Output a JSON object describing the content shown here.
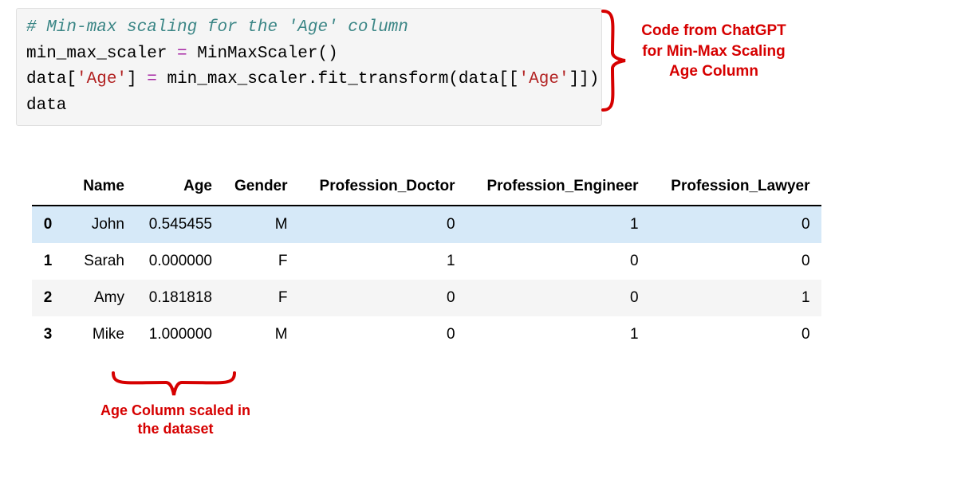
{
  "code": {
    "comment": "# Min-max scaling for the 'Age' column",
    "line1_a": "min_max_scaler ",
    "line1_op": "=",
    "line1_b": " MinMaxScaler()",
    "line2_a": "data[",
    "line2_str1": "'Age'",
    "line2_b": "] ",
    "line2_op": "=",
    "line2_c": " min_max_scaler.fit_transform(data[[",
    "line2_str2": "'Age'",
    "line2_d": "]])",
    "line3": "data"
  },
  "annotations": {
    "right_l1": "Code from ChatGPT",
    "right_l2": "for Min-Max Scaling",
    "right_l3": "Age Column",
    "bottom_l1": "Age Column scaled in",
    "bottom_l2": "the dataset"
  },
  "table": {
    "headers": {
      "name": "Name",
      "age": "Age",
      "gender": "Gender",
      "pd": "Profession_Doctor",
      "pe": "Profession_Engineer",
      "pl": "Profession_Lawyer"
    },
    "rows": [
      {
        "idx": "0",
        "name": "John",
        "age": "0.545455",
        "gender": "M",
        "pd": "0",
        "pe": "1",
        "pl": "0"
      },
      {
        "idx": "1",
        "name": "Sarah",
        "age": "0.000000",
        "gender": "F",
        "pd": "1",
        "pe": "0",
        "pl": "0"
      },
      {
        "idx": "2",
        "name": "Amy",
        "age": "0.181818",
        "gender": "F",
        "pd": "0",
        "pe": "0",
        "pl": "1"
      },
      {
        "idx": "3",
        "name": "Mike",
        "age": "1.000000",
        "gender": "M",
        "pd": "0",
        "pe": "1",
        "pl": "0"
      }
    ]
  },
  "chart_data": {
    "type": "table",
    "columns": [
      "Name",
      "Age",
      "Gender",
      "Profession_Doctor",
      "Profession_Engineer",
      "Profession_Lawyer"
    ],
    "rows": [
      [
        "John",
        0.545455,
        "M",
        0,
        1,
        0
      ],
      [
        "Sarah",
        0.0,
        "F",
        1,
        0,
        0
      ],
      [
        "Amy",
        0.181818,
        "F",
        0,
        0,
        1
      ],
      [
        "Mike",
        1.0,
        "M",
        0,
        1,
        0
      ]
    ]
  }
}
